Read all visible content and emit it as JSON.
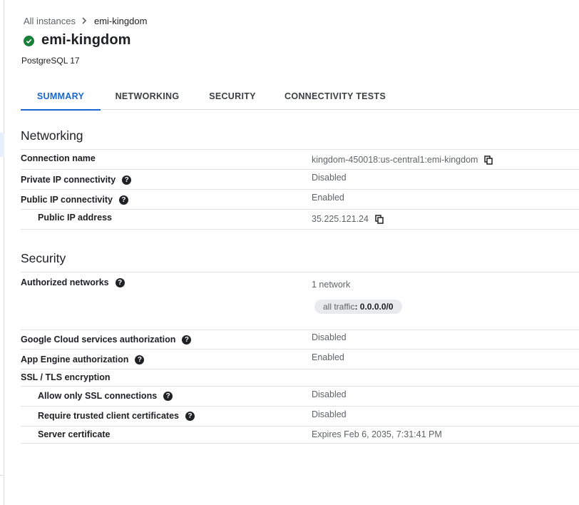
{
  "breadcrumb": {
    "parent": "All instances",
    "current": "emi-kingdom"
  },
  "instance": {
    "name": "emi-kingdom",
    "status": "running",
    "engine": "PostgreSQL 17"
  },
  "tabs": [
    {
      "label": "SUMMARY",
      "active": true
    },
    {
      "label": "NETWORKING",
      "active": false
    },
    {
      "label": "SECURITY",
      "active": false
    },
    {
      "label": "CONNECTIVITY TESTS",
      "active": false
    }
  ],
  "networking": {
    "title": "Networking",
    "rows": [
      {
        "label": "Connection name",
        "value": "kingdom-450018:us-central1:emi-kingdom",
        "copy": true
      },
      {
        "label": "Private IP connectivity",
        "value": "Disabled",
        "help": true
      },
      {
        "label": "Public IP connectivity",
        "value": "Enabled",
        "help": true
      },
      {
        "label": "Public IP address",
        "value": "35.225.121.24",
        "copy": true,
        "indent": true
      }
    ]
  },
  "security": {
    "title": "Security",
    "authorized_networks": {
      "label": "Authorized networks",
      "value": "1 network",
      "chip_key": "all traffic",
      "chip_value": ": 0.0.0.0/0"
    },
    "rows": [
      {
        "label": "Google Cloud services authorization",
        "value": "Disabled",
        "help": true
      },
      {
        "label": "App Engine authorization",
        "value": "Enabled",
        "help": true
      },
      {
        "label": "SSL / TLS encryption",
        "value": ""
      },
      {
        "label": "Allow only SSL connections",
        "value": "Disabled",
        "help": true,
        "indent": true
      },
      {
        "label": "Require trusted client certificates",
        "value": "Disabled",
        "help": true,
        "indent": true
      },
      {
        "label": "Server certificate",
        "value": "Expires Feb 6, 2035, 7:31:41 PM",
        "indent": true
      }
    ]
  },
  "icons": {
    "help": "?"
  },
  "colors": {
    "accent": "#1967d2",
    "status_ok": "#188038"
  }
}
